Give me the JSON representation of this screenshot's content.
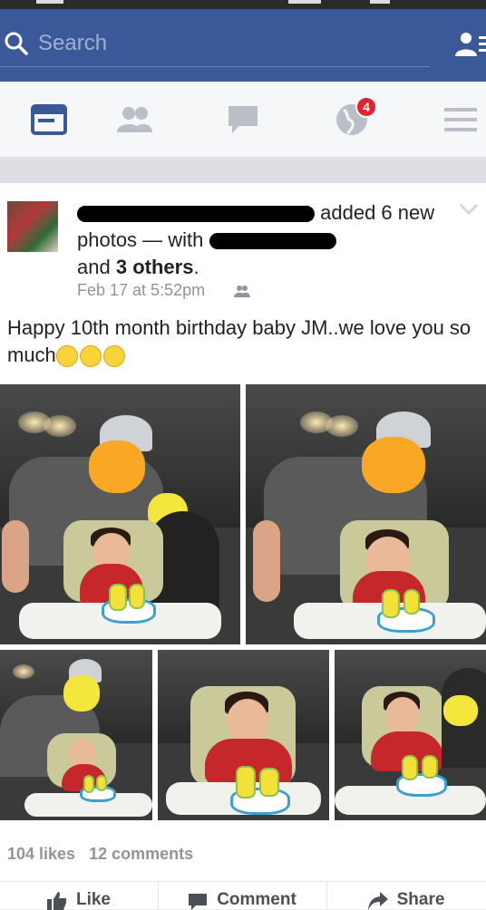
{
  "search": {
    "placeholder": "Search"
  },
  "nav": {
    "notifications_badge": "4"
  },
  "post": {
    "author_suffix": "added 6 new photos — with",
    "others_prefix": "and",
    "others_count": "3 others",
    "others_suffix": ".",
    "timestamp": "Feb 17 at 5:52pm",
    "caption": "Happy 10th month birthday baby JM..we love you so much",
    "likes": "104 likes",
    "comments": "12 comments"
  },
  "actions": {
    "like": "Like",
    "comment": "Comment",
    "share": "Share"
  },
  "colors": {
    "brand": "#3b5998",
    "badge": "#e0262c",
    "muted": "#90949c"
  }
}
